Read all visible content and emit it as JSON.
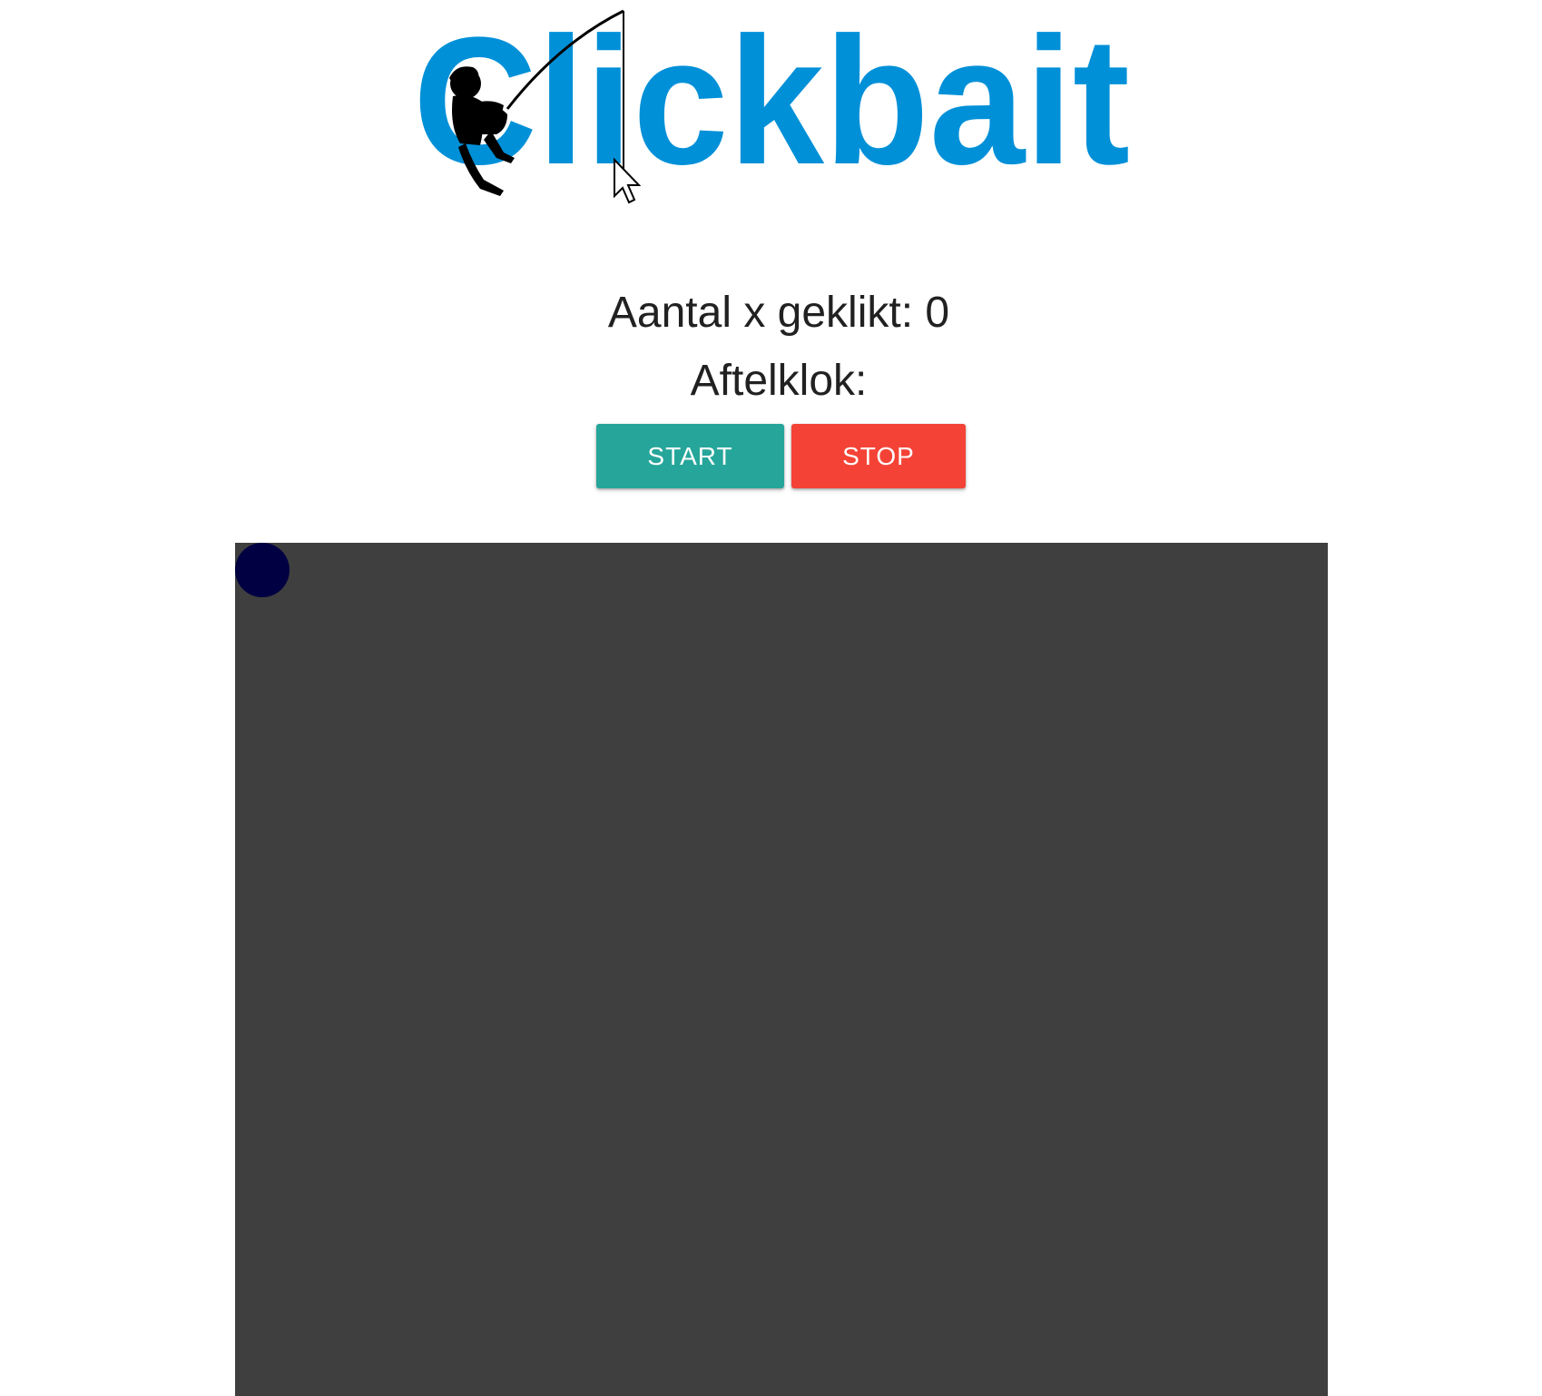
{
  "logo": {
    "text": "Clickbait",
    "color": "#0090d8"
  },
  "stats": {
    "counter_label": "Aantal x geklikt: 0",
    "countdown_label": "Aftelklok:"
  },
  "controls": {
    "start_label": "START",
    "stop_label": "STOP",
    "start_color": "#26a69a",
    "stop_color": "#f44336"
  },
  "game": {
    "background_color": "#3f3f3f",
    "target_color": "#000042"
  }
}
